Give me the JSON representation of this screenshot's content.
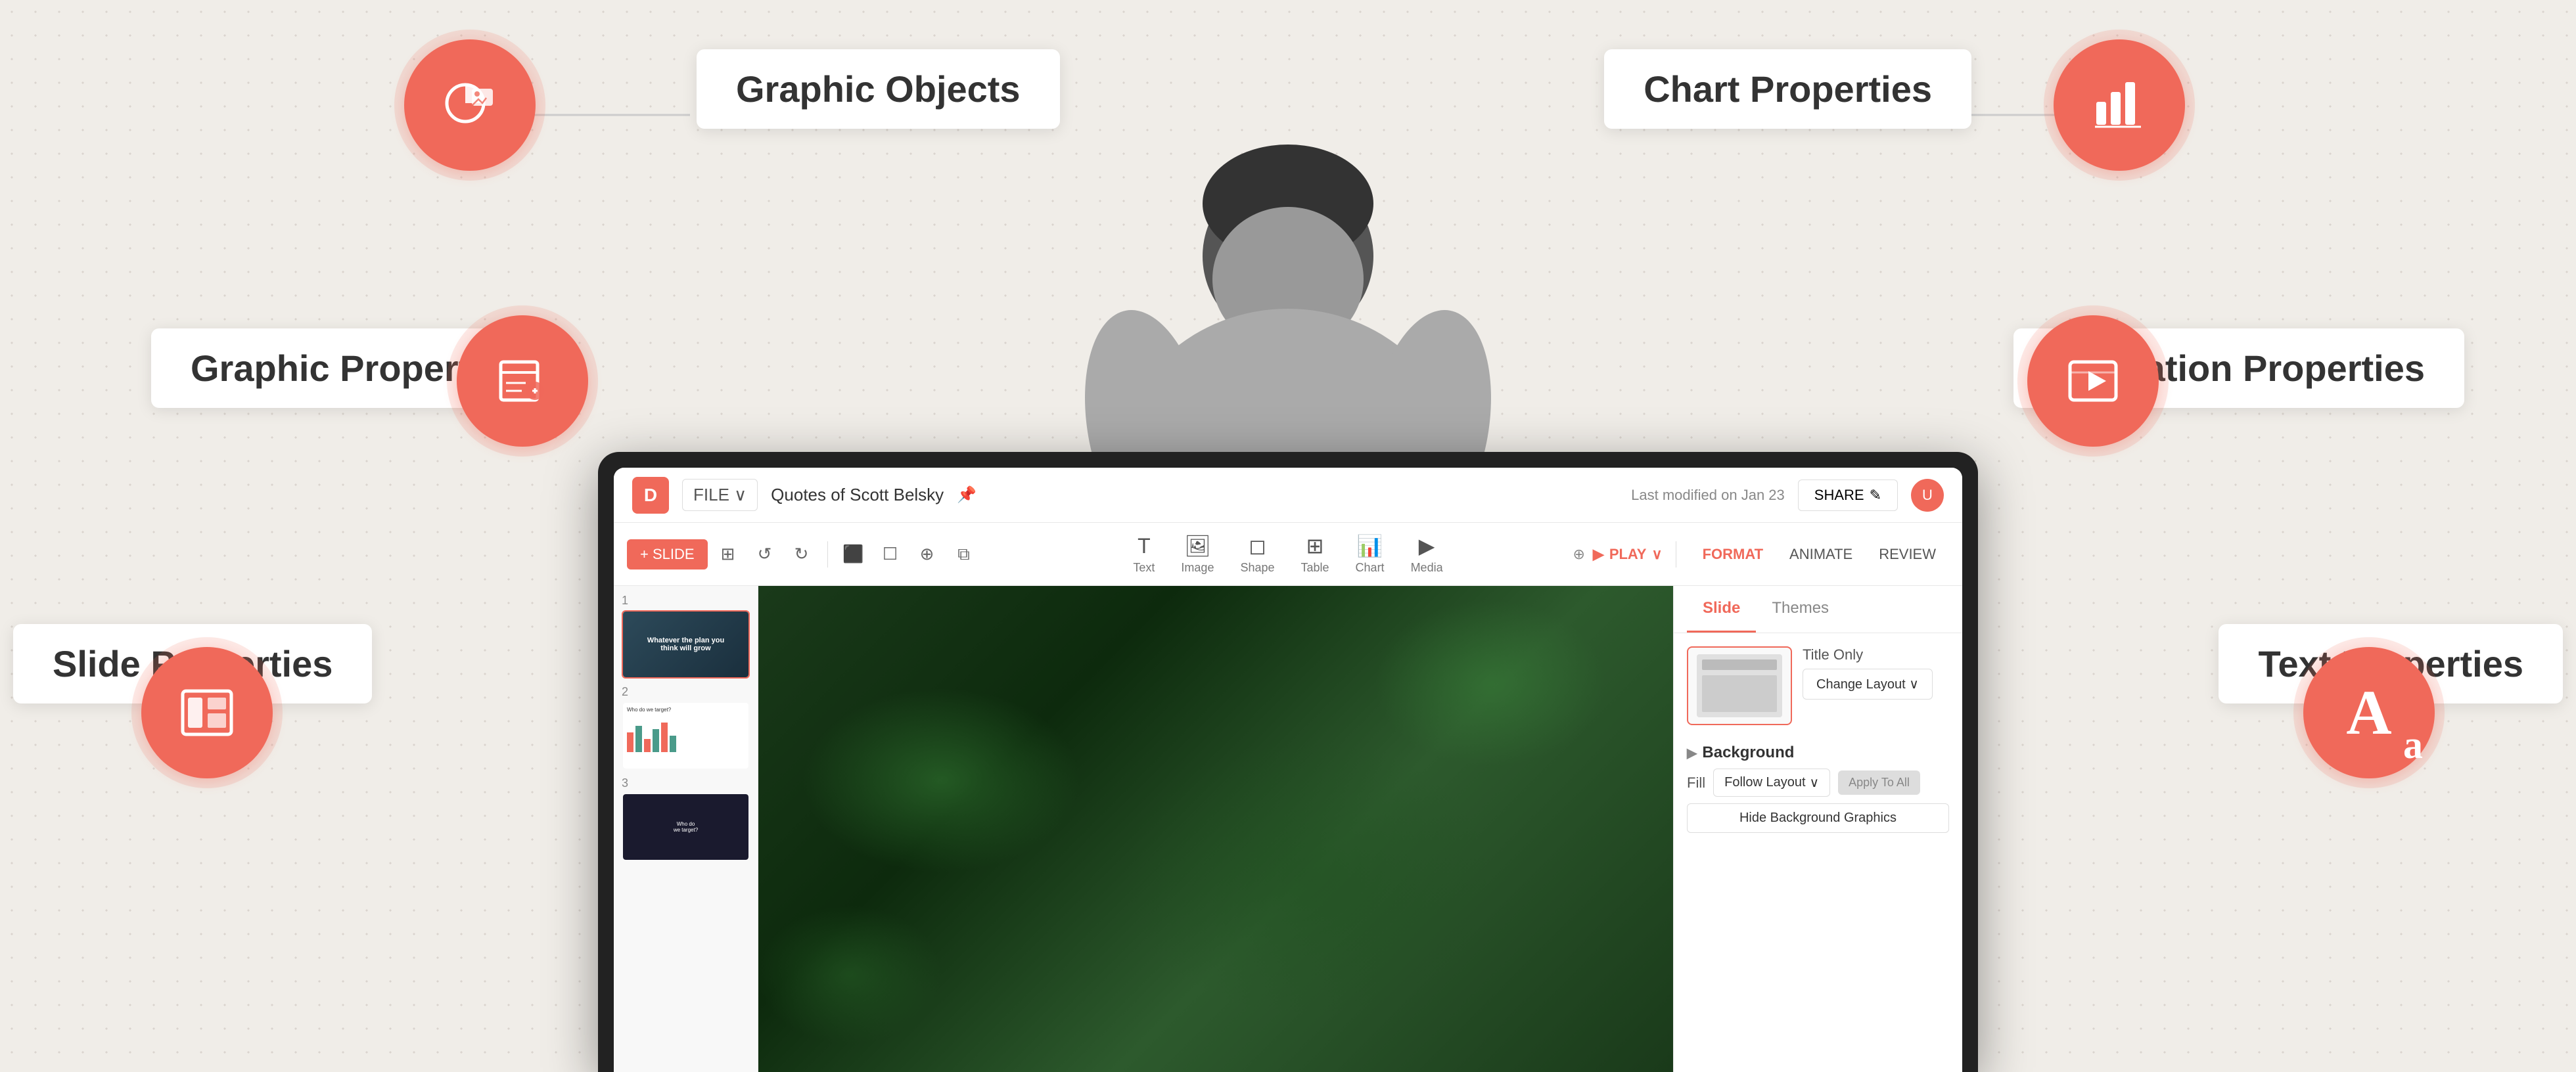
{
  "background": {
    "color": "#f0ede8"
  },
  "labels": {
    "graphic_objects": "Graphic Objects",
    "chart_properties": "Chart Properties",
    "graphic_properties": "Graphic Properties",
    "animation_properties": "Animation Properties",
    "slide_properties": "Slide Properties",
    "text_properties": "Text Properties"
  },
  "monitor": {
    "topbar": {
      "logo": "D",
      "file_label": "FILE ∨",
      "title": "Quotes of Scott Belsky",
      "pin_icon": "📌",
      "modified_text": "Last modified on Jan 23",
      "share_label": "SHARE",
      "share_icon": "✎"
    },
    "toolbar": {
      "slide_btn": "+ SLIDE",
      "undo_icon": "↺",
      "redo_icon": "↻",
      "tools": [
        {
          "label": "Text",
          "icon": "T"
        },
        {
          "label": "Image",
          "icon": "🖼"
        },
        {
          "label": "Shape",
          "icon": "◻"
        },
        {
          "label": "Table",
          "icon": "⊞"
        },
        {
          "label": "Chart",
          "icon": "📊"
        },
        {
          "label": "Media",
          "icon": "▶"
        }
      ],
      "play_label": "PLAY",
      "format_tab": "FORMAT",
      "animate_tab": "ANIMATE",
      "review_tab": "REVIEW"
    },
    "slides": [
      {
        "num": "1",
        "type": "dark_title",
        "text": "Whatever the plan you think will grow"
      },
      {
        "num": "2",
        "type": "chart"
      },
      {
        "num": "3",
        "type": "dark_content"
      }
    ],
    "right_panel": {
      "tabs": [
        "Slide",
        "Themes"
      ],
      "active_tab": "Slide",
      "layout_name": "Title Only",
      "change_layout_btn": "Change Layout ∨",
      "background_section": "Background",
      "fill_label": "Fill",
      "follow_layout_label": "Follow Layout",
      "follow_layout_dropdown_arrow": "∨",
      "apply_btn": "Apply To All",
      "hide_bg_btn": "Hide Background Graphics"
    }
  },
  "icons": {
    "graphic_objects": "🖼",
    "chart_properties": "📊",
    "graphic_properties": "✏",
    "animation_properties": "▶",
    "slide_properties": "▦",
    "text_properties": "Aa"
  }
}
